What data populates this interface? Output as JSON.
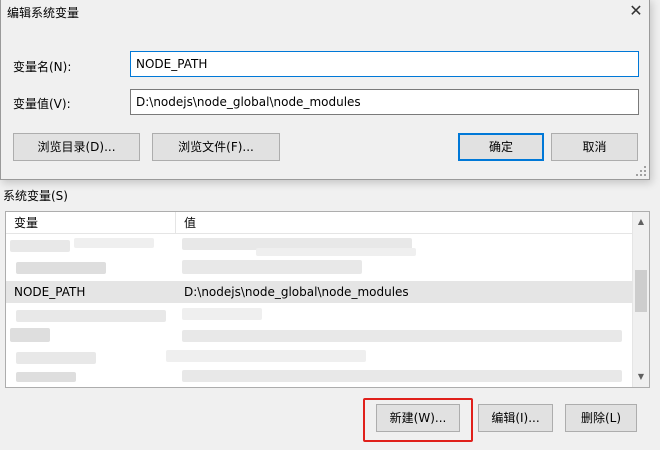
{
  "dialog": {
    "title": "编辑系统变量",
    "name_label": "变量名(N):",
    "name_value": "NODE_PATH",
    "value_label": "变量值(V):",
    "value_value": "D:\\nodejs\\node_global\\node_modules",
    "browse_dir_label": "浏览目录(D)...",
    "browse_file_label": "浏览文件(F)...",
    "ok_label": "确定",
    "cancel_label": "取消",
    "close_glyph": "✕"
  },
  "system_vars": {
    "section_label": "系统变量(S)",
    "col_var": "变量",
    "col_value": "值",
    "selected_row": {
      "var": "NODE_PATH",
      "value": "D:\\nodejs\\node_global\\node_modules"
    },
    "new_label": "新建(W)...",
    "edit_label": "编辑(I)...",
    "delete_label": "删除(L)"
  },
  "colors": {
    "accent": "#0078d7",
    "highlight": "#e0201b",
    "selection": "#e5e5e5"
  }
}
